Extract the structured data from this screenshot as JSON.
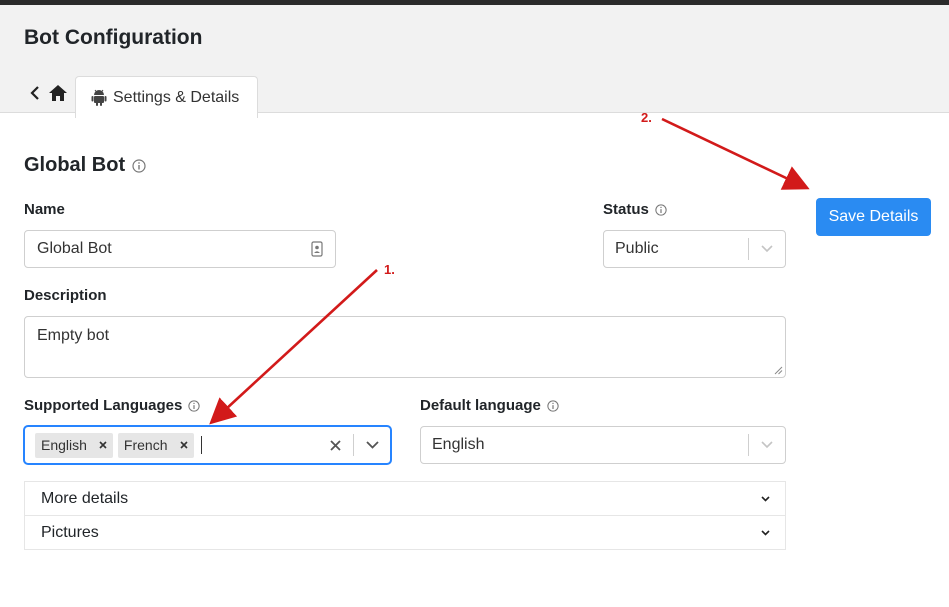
{
  "header": {
    "title": "Bot Configuration",
    "tab_label": "Settings & Details"
  },
  "section": {
    "title": "Global Bot"
  },
  "form": {
    "name_label": "Name",
    "name_value": "Global Bot",
    "status_label": "Status",
    "status_value": "Public",
    "description_label": "Description",
    "description_value": "Empty bot",
    "supported_languages_label": "Supported Languages",
    "supported_languages": [
      "English",
      "French"
    ],
    "default_language_label": "Default language",
    "default_language_value": "English"
  },
  "accordion": {
    "items": [
      {
        "label": "More details"
      },
      {
        "label": "Pictures"
      }
    ]
  },
  "actions": {
    "save_label": "Save Details"
  },
  "annotations": {
    "step1": "1.",
    "step2": "2."
  },
  "colors": {
    "primary": "#2a8bf2",
    "focus": "#2684ff",
    "annotation": "#d21a1a"
  },
  "icons": [
    "chevron-left-icon",
    "home-icon",
    "android-icon",
    "info-icon",
    "contact-card-icon",
    "chevron-down-icon",
    "close-icon",
    "resize-handle-icon"
  ]
}
